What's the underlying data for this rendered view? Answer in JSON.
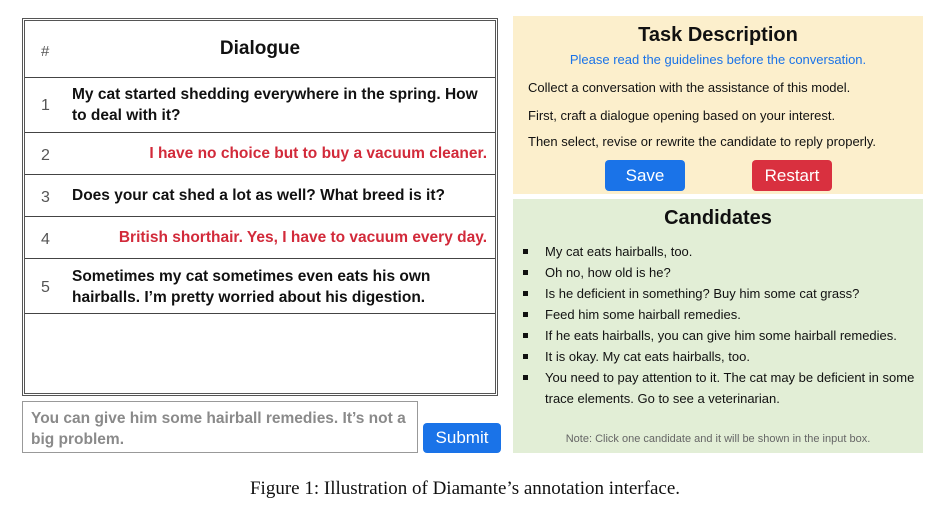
{
  "dialogue": {
    "hash": "#",
    "title": "Dialogue",
    "rows": [
      {
        "num": "1",
        "speaker": "user",
        "text": "My cat started shedding everywhere in the spring. How to deal with it?"
      },
      {
        "num": "2",
        "speaker": "bot",
        "text": "I have no choice but to buy a vacuum cleaner."
      },
      {
        "num": "3",
        "speaker": "user",
        "text": "Does your cat shed a lot as well? What breed is it?"
      },
      {
        "num": "4",
        "speaker": "bot",
        "text": "British shorthair. Yes, I have to vacuum every day."
      },
      {
        "num": "5",
        "speaker": "user",
        "text": "Sometimes my cat sometimes even eats his own hairballs. I’m pretty worried about his digestion."
      }
    ]
  },
  "input": {
    "value": "You can give him some hairball remedies. It’s not a big problem."
  },
  "submit_label": "Submit",
  "task": {
    "title": "Task Description",
    "guideline": "Please read the guidelines before the conversation.",
    "lines": [
      "Collect a conversation with the assistance of this model.",
      "First, craft a dialogue opening based on your interest.",
      "Then select, revise or rewrite the candidate to reply properly."
    ],
    "save_label": "Save",
    "restart_label": "Restart"
  },
  "candidates": {
    "title": "Candidates",
    "items": [
      "My cat eats hairballs, too.",
      "Oh no, how old is he?",
      "Is he deficient in something? Buy him some cat grass?",
      "Feed him some hairball remedies.",
      "If he eats hairballs, you can give him some hairball remedies.",
      "It is okay. My cat eats hairballs, too.",
      "You need to pay attention to it. The cat may be deficient in some trace elements. Go to see a veterinarian."
    ],
    "note": "Note: Click one candidate and it will be shown in the input box."
  },
  "caption": "Figure 1: Illustration of Diamante’s annotation interface.",
  "colors": {
    "accent_blue": "#1a73e8",
    "bot_red": "#d22a3a",
    "restart_red": "#d9303f",
    "task_bg": "#fcefcc",
    "candidates_bg": "#e2eed6"
  }
}
